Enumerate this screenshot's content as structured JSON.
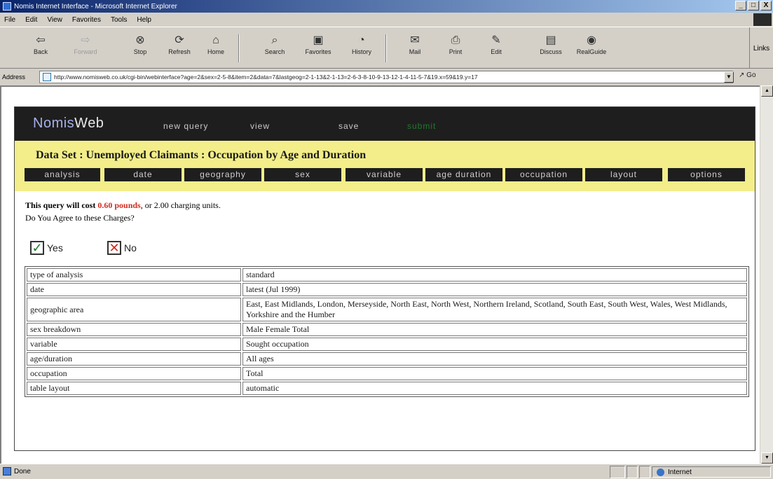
{
  "window": {
    "title": "Nomis Internet Interface - Microsoft Internet Explorer",
    "controls": [
      "_",
      "□",
      "X"
    ]
  },
  "menu": [
    "File",
    "Edit",
    "View",
    "Favorites",
    "Tools",
    "Help"
  ],
  "toolbar": {
    "buttons": [
      {
        "label": "Back",
        "icon": "back-arrow-icon",
        "glyph": "⇦"
      },
      {
        "label": "Forward",
        "icon": "forward-arrow-icon",
        "glyph": "⇨"
      },
      {
        "label": "Stop",
        "icon": "stop-icon",
        "glyph": "⊗"
      },
      {
        "label": "Refresh",
        "icon": "refresh-icon",
        "glyph": "⟳"
      },
      {
        "label": "Home",
        "icon": "home-icon",
        "glyph": "⌂"
      },
      {
        "label": "Search",
        "icon": "search-icon",
        "glyph": "⌕"
      },
      {
        "label": "Favorites",
        "icon": "favorites-icon",
        "glyph": "▣"
      },
      {
        "label": "History",
        "icon": "history-icon",
        "glyph": "◔"
      },
      {
        "label": "Mail",
        "icon": "mail-icon",
        "glyph": "✉"
      },
      {
        "label": "Print",
        "icon": "print-icon",
        "glyph": "⎙"
      },
      {
        "label": "Edit",
        "icon": "edit-icon",
        "glyph": "✎"
      },
      {
        "label": "Discuss",
        "icon": "discuss-icon",
        "glyph": "▤"
      },
      {
        "label": "RealGuide",
        "icon": "realguide-icon",
        "glyph": "◉"
      }
    ],
    "links_label": "Links"
  },
  "address": {
    "label": "Address",
    "url": "http://www.nomisweb.co.uk/cgi-bin/webinterface?age=2&sex=2-5-8&item=2&data=7&lastgeog=2-1-13&2-1-13=2-6-3-8-10-9-13-12-1-4-11-5-7&19.x=59&19.y=17",
    "go_label": "Go"
  },
  "nomis": {
    "logo_nomis": "Nomis",
    "logo_web": "Web",
    "nav": [
      "new query",
      "view",
      "save",
      "submit"
    ],
    "dataset_title": "Data Set : Unemployed Claimants : Occupation by Age and Duration",
    "tabs": [
      "analysis",
      "date",
      "geography",
      "sex",
      "variable",
      "age duration",
      "occupation",
      "layout",
      "options"
    ]
  },
  "cost": {
    "prefix": "This query will cost ",
    "amount": "0.60 pounds",
    "suffix": ", or 2.00 charging units.",
    "question": "Do You Agree to these Charges?",
    "yes_label": "Yes",
    "no_label": "No"
  },
  "summary_rows": [
    {
      "key": "type of analysis",
      "value": "standard"
    },
    {
      "key": "date",
      "value": "latest (Jul 1999)"
    },
    {
      "key": "geographic area",
      "value": "East, East Midlands, London, Merseyside, North East, North West, Northern Ireland, Scotland, South East, South West, Wales, West Midlands, Yorkshire and the Humber"
    },
    {
      "key": "sex breakdown",
      "value": "Male Female Total"
    },
    {
      "key": "variable",
      "value": "Sought occupation"
    },
    {
      "key": "age/duration",
      "value": "All ages"
    },
    {
      "key": "occupation",
      "value": "Total"
    },
    {
      "key": "table layout",
      "value": "automatic"
    }
  ],
  "status": {
    "text": "Done",
    "zone": "Internet"
  },
  "colors": {
    "header_bg": "#1e1e1e",
    "dataset_bar": "#f3ee8a",
    "cost_red": "#d42b1e",
    "yes_green": "#1c7c2a"
  }
}
